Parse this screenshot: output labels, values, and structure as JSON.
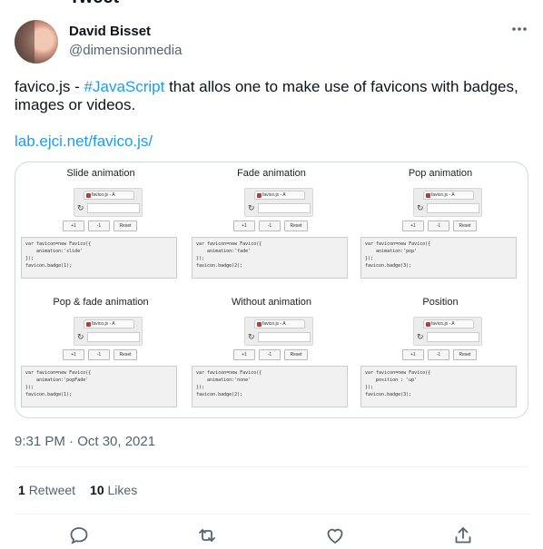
{
  "top_cut_title": "Tweet",
  "author": {
    "name": "David Bisset",
    "handle": "@dimensionmedia"
  },
  "more_icon": "more-dots-icon",
  "tweet": {
    "text_before": "favico.js - ",
    "hashtag": "#JavaScript",
    "text_after": " that allos one to make use of favicons with badges, images or videos.",
    "link": "lab.ejci.net/favico.js/"
  },
  "media": {
    "cells": [
      {
        "title": "Slide animation",
        "tab": "favico.js - A",
        "code": "var favicon=new Favico({\n    animation:'slide'\n});\nfavicon.badge(1);"
      },
      {
        "title": "Fade animation",
        "tab": "favico.js - A",
        "code": "var favicon=new Favico({\n    animation:'fade'\n});\nfavicon.badge(2);"
      },
      {
        "title": "Pop animation",
        "tab": "favico.js - A",
        "code": "var favicon=new Favico({\n    animation:'pop'\n});\nfavicon.badge(3);"
      },
      {
        "title": "Pop & fade animation",
        "tab": "favico.js - A",
        "code": "var favicon=new Favico({\n    animation:'popFade'\n});\nfavicon.badge(1);"
      },
      {
        "title": "Without animation",
        "tab": "favico.js - A",
        "code": "var favicon=new Favico({\n    animation:'none'\n});\nfavicon.badge(2);"
      },
      {
        "title": "Position",
        "tab": "favico.js - A",
        "code": "var favicon=new Favico({\n    position : 'up'\n});\nfavicon.badge(3);"
      }
    ],
    "buttons": [
      "+1",
      "-1",
      "Reset"
    ]
  },
  "timestamp": "9:31 PM · Oct 30, 2021",
  "stats": {
    "retweets_count": "1",
    "retweets_label": "Retweet",
    "likes_count": "10",
    "likes_label": "Likes"
  },
  "actions": [
    "reply-icon",
    "retweet-icon",
    "like-icon",
    "share-icon"
  ],
  "colors": {
    "accent": "#1d9bf0",
    "secondary_text": "#536471",
    "text": "#0f1419"
  }
}
